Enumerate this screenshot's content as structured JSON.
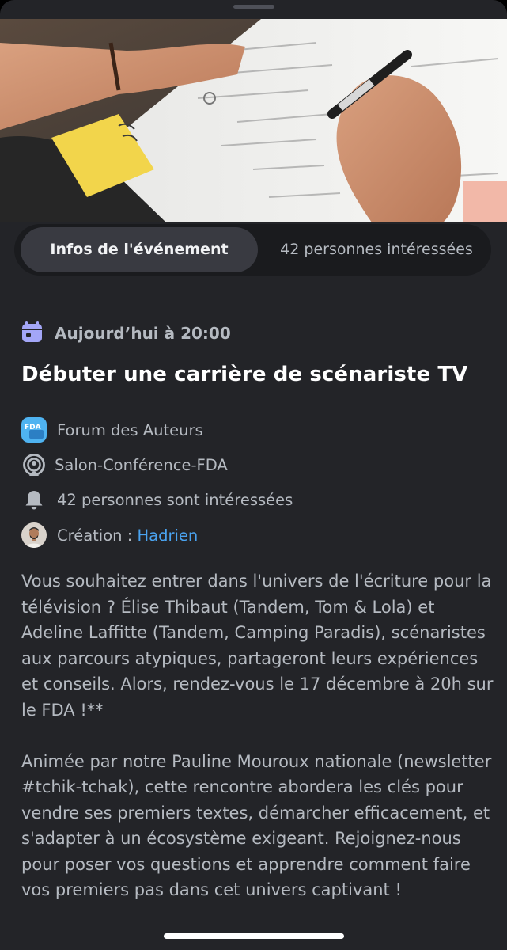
{
  "tabs": {
    "info": "Infos de l'événement",
    "interested": "42 personnes intéressées"
  },
  "event": {
    "date_label": "Aujourd’hui à 20:00",
    "title": "Débuter une carrière de scénariste TV",
    "server_icon_text": "FDA",
    "server": "Forum des Auteurs",
    "channel": "Salon-Conférence-FDA",
    "interested": "42 personnes sont intéressées",
    "creator_prefix": "Création : ",
    "creator_name": "Hadrien",
    "description": [
      "Vous souhaitez entrer dans l'univers de l'écriture pour la télévision ? Élise Thibaut (Tandem, Tom & Lola) et Adeline Laffitte (Tandem, Camping Paradis), scénaristes aux parcours atypiques, partageront leurs expériences et conseils. Alors, rendez-vous le 17 décembre à 20h sur le FDA !**",
      "Animée par notre Pauline Mouroux nationale (newsletter #tchik-tchak), cette rencontre abordera les clés pour vendre ses premiers textes, démarcher efficacement, et s'adapter à un écosystème exigeant. Rejoignez-nous pour poser vos questions et apprendre comment faire vos premiers pas dans cet univers captivant !"
    ]
  },
  "icons": {
    "calendar": "calendar-icon",
    "server": "server-icon",
    "channel": "stage-channel-icon",
    "bell": "bell-icon",
    "avatar": "avatar"
  },
  "colors": {
    "background": "#232428",
    "accent_calendar": "#a3a6f7",
    "link": "#4aa3f0",
    "server_icon": "#4fb3f1"
  }
}
